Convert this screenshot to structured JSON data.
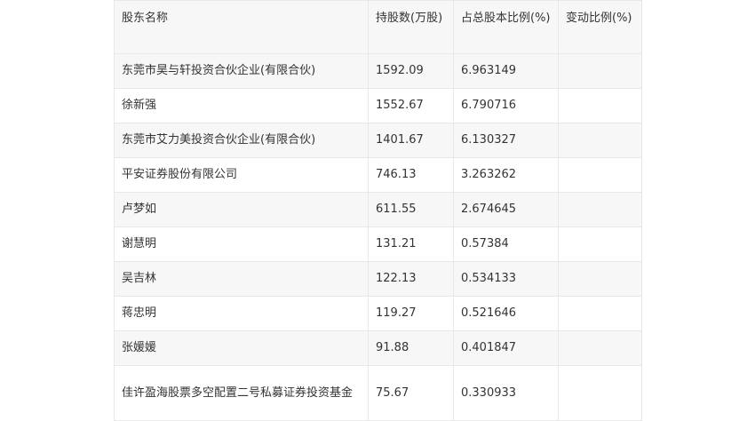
{
  "table": {
    "headers": [
      "股东名称",
      "持股数(万股)",
      "占总股本比例(%)",
      "变动比例(%)"
    ],
    "rows": [
      [
        "东莞市昊与轩投资合伙企业(有限合伙)",
        "1592.09",
        "6.963149",
        ""
      ],
      [
        "徐新强",
        "1552.67",
        "6.790716",
        ""
      ],
      [
        "东莞市艾力美投资合伙企业(有限合伙)",
        "1401.67",
        "6.130327",
        ""
      ],
      [
        "平安证券股份有限公司",
        "746.13",
        "3.263262",
        ""
      ],
      [
        "卢梦如",
        "611.55",
        "2.674645",
        ""
      ],
      [
        "谢慧明",
        "131.21",
        "0.57384",
        ""
      ],
      [
        "吴吉林",
        "122.13",
        "0.534133",
        ""
      ],
      [
        "蒋忠明",
        "119.27",
        "0.521646",
        ""
      ],
      [
        "张媛媛",
        "91.88",
        "0.401847",
        ""
      ],
      [
        "佳许盈海股票多空配置二号私募证券投资基金",
        "75.67",
        "0.330933",
        ""
      ]
    ]
  }
}
